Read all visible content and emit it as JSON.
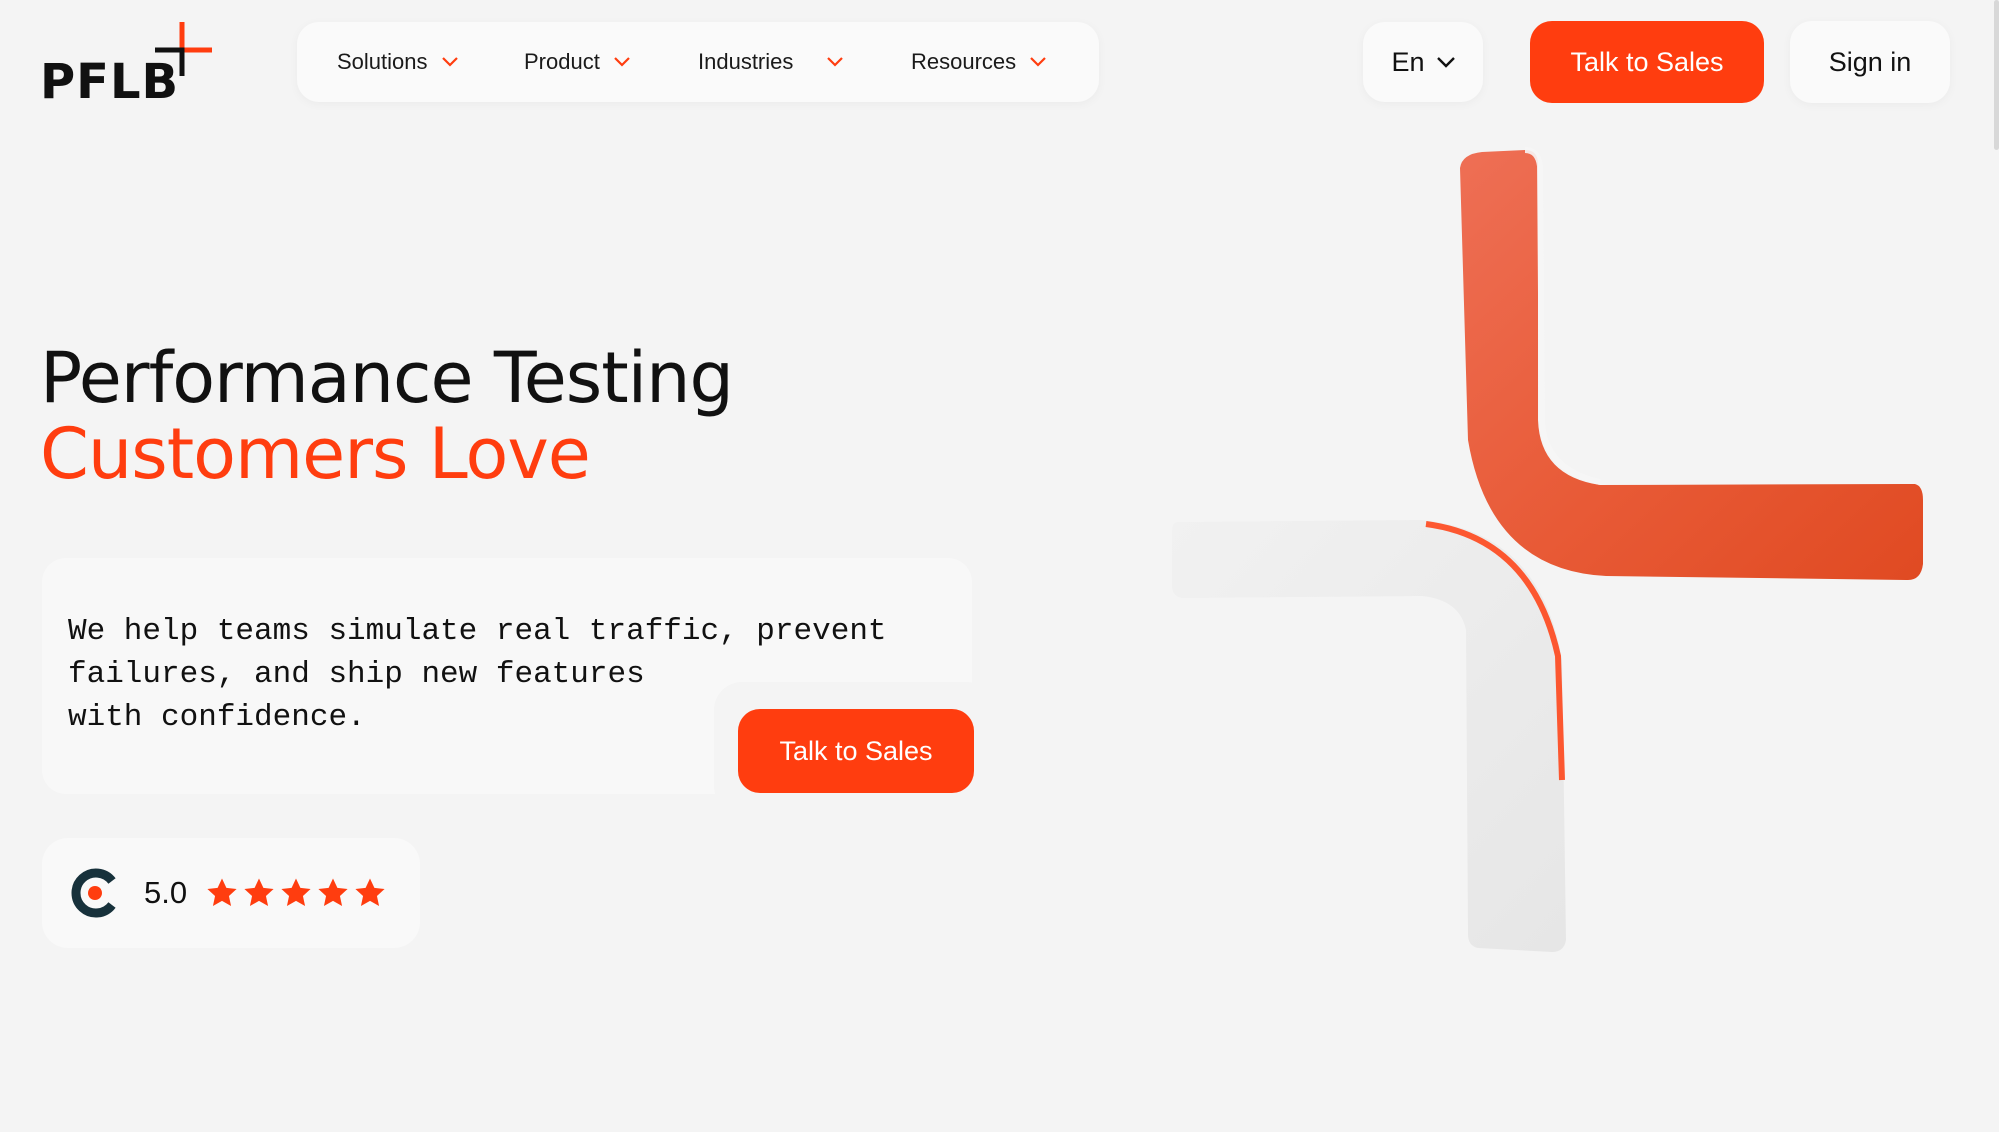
{
  "brand": {
    "name": "PFLB"
  },
  "nav": {
    "items": [
      {
        "label": "Solutions"
      },
      {
        "label": "Product"
      },
      {
        "label": "Industries"
      },
      {
        "label": "Resources"
      }
    ]
  },
  "header": {
    "language": "En",
    "cta_label": "Talk to Sales",
    "signin_label": "Sign in"
  },
  "hero": {
    "title_line1": "Performance Testing",
    "title_line2": "Customers Love",
    "description_lines": [
      "We help teams simulate real traffic, prevent",
      "failures, and ship new features",
      "with confidence."
    ],
    "cta_label": "Talk to Sales"
  },
  "rating": {
    "value": "5.0",
    "stars": 5,
    "max_stars": 5,
    "platform_icon": "clutch-logo-icon"
  },
  "colors": {
    "accent": "#ff3d0f",
    "background": "#f4f4f4",
    "text": "#111111"
  }
}
